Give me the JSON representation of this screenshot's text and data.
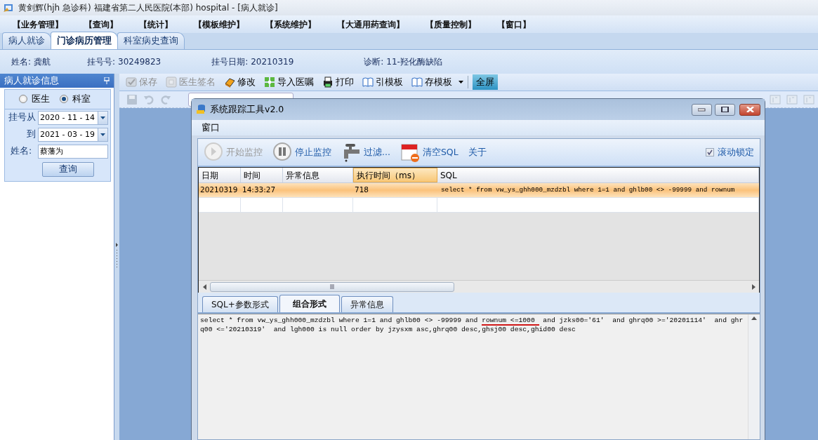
{
  "window": {
    "title": "黄剑辉(hjh 急诊科) 福建省第二人民医院(本部) hospital - [病人就诊]"
  },
  "menu": [
    "【业务管理】",
    "【查询】",
    "【统计】",
    "【模板维护】",
    "【系统维护】",
    "【大通用药查询】",
    "【质量控制】",
    "【窗口】"
  ],
  "tabs": [
    {
      "label": "病人就诊",
      "selected": false
    },
    {
      "label": "门诊病历管理",
      "selected": true
    },
    {
      "label": "科室病史查询",
      "selected": false
    }
  ],
  "patient": [
    {
      "label": "姓名:",
      "value": "龚航"
    },
    {
      "label": "挂号号:",
      "value": "30249823"
    },
    {
      "label": "挂号日期:",
      "value": "20210319"
    },
    {
      "label": "诊断:",
      "value": "11-羟化酶缺陷"
    }
  ],
  "side_panel": {
    "title": "病人就诊信息",
    "radios": [
      {
        "label": "医生",
        "selected": false
      },
      {
        "label": "科室",
        "selected": true
      }
    ],
    "date_from": {
      "label": "挂号从",
      "value": "2020 - 11 - 14"
    },
    "date_to": {
      "label": "到",
      "value": "2021 - 03 - 19"
    },
    "name": {
      "label": "姓名:",
      "value": "蔡藩为"
    },
    "button": "查询"
  },
  "toolbar": [
    {
      "label": "保存",
      "disabled": true
    },
    {
      "label": "医生签名",
      "disabled": true
    },
    {
      "label": "修改",
      "disabled": false
    },
    {
      "label": "导入医嘱",
      "disabled": false
    },
    {
      "label": "打印",
      "disabled": false
    },
    {
      "label": "引模板",
      "disabled": false
    },
    {
      "label": "存模板",
      "disabled": false
    }
  ],
  "fullscreen_button": {
    "label": "全屏",
    "pressed": true
  },
  "dialog": {
    "title": "系统跟踪工具v2.0",
    "menu": [
      "窗口"
    ],
    "toolbar": [
      {
        "label": "开始监控",
        "disabled": true
      },
      {
        "label": "停止监控",
        "disabled": false
      },
      {
        "label": "过滤...",
        "disabled": false
      },
      {
        "label": "清空SQL",
        "disabled": false
      },
      {
        "label": "关于",
        "disabled": false
      }
    ],
    "scroll_lock": {
      "label": "滚动锁定",
      "checked": true
    },
    "columns": [
      {
        "label": "日期",
        "selected": false
      },
      {
        "label": "时间",
        "selected": false
      },
      {
        "label": "异常信息",
        "selected": false
      },
      {
        "label": "执行时间（ms）",
        "selected": true
      },
      {
        "label": "SQL",
        "selected": false
      }
    ],
    "rows": [
      {
        "selected": true,
        "cells": [
          "20210319",
          "14:33:27",
          "",
          "718",
          "select * from vw_ys_ghh000_mzdzbl where 1=1 and ghlb00 <> -99999 and rownum"
        ]
      },
      {
        "selected": false,
        "cells": [
          "",
          "",
          "",
          "",
          ""
        ]
      }
    ],
    "tabs": [
      {
        "label": "SQL+参数形式",
        "selected": false
      },
      {
        "label": "组合形式",
        "selected": true
      },
      {
        "label": "异常信息",
        "selected": false
      }
    ],
    "sql_text": {
      "before": "select * from vw_ys_ghh000_mzdzbl where 1=1 and ghlb00 <> -99999 and ",
      "underlined": "rownum <=1000 ",
      "after": " and jzks00='61'  and ghrq00 >='20201114'  and ghrq00 <='20210319'  and lgh000 is null order by jzysxm asc,ghrq00 desc,ghsj00 desc,ghid00 desc"
    }
  }
}
